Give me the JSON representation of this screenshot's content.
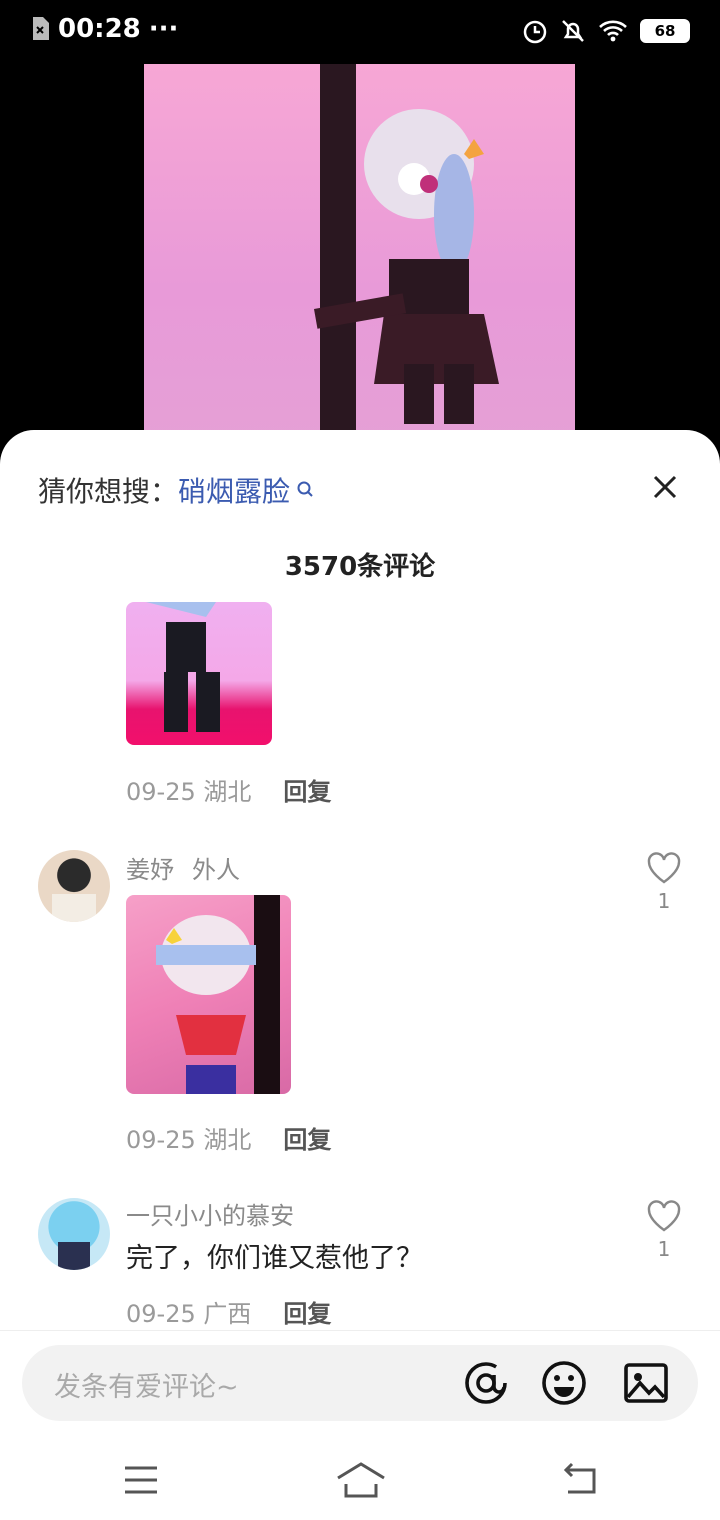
{
  "status": {
    "time": "00:28",
    "more": "···",
    "battery": "68"
  },
  "sheet": {
    "suggest_label": "猜你想搜：",
    "suggest_query": "硝烟露脸",
    "comment_count": "3570条评论"
  },
  "comments": [
    {
      "date": "09-25",
      "region": "湖北",
      "reply": "回复"
    },
    {
      "user": "姜妤",
      "tag": "外人",
      "date": "09-25",
      "region": "湖北",
      "reply": "回复",
      "likes": "1"
    },
    {
      "user": "一只小小的慕安",
      "text": "完了，你们谁又惹他了？",
      "date": "09-25",
      "region": "广西",
      "reply": "回复",
      "likes": "1"
    }
  ],
  "input": {
    "placeholder": "发条有爱评论~"
  },
  "icons": {
    "search": "search-icon",
    "close": "close-icon",
    "heart": "heart-icon",
    "mention": "at-icon",
    "emoji": "emoji-icon",
    "image": "image-icon",
    "menu": "menu-icon",
    "home": "home-icon",
    "back": "back-icon"
  },
  "colors": {
    "accent": "#3b5bb0",
    "pink": "#f7a7d5"
  }
}
